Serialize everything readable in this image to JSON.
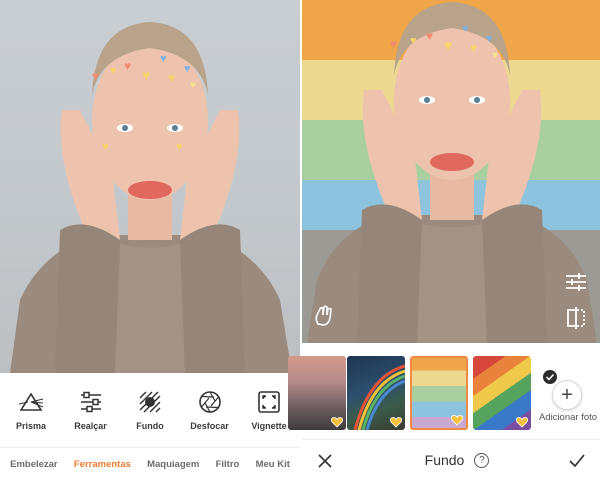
{
  "editor_tools": {
    "tools": [
      {
        "label": "Prisma",
        "icon": "prism-icon"
      },
      {
        "label": "Realçar",
        "icon": "sliders-icon"
      },
      {
        "label": "Fundo",
        "icon": "background-icon"
      },
      {
        "label": "Desfocar",
        "icon": "aperture-icon"
      },
      {
        "label": "Vignette",
        "icon": "vignette-icon"
      }
    ]
  },
  "bottom_nav": {
    "items": [
      {
        "label": "Embelezar",
        "active": false
      },
      {
        "label": "Ferramentas",
        "active": true
      },
      {
        "label": "Maquiagem",
        "active": false
      },
      {
        "label": "Filtro",
        "active": false
      },
      {
        "label": "Meu Kit",
        "active": false
      }
    ]
  },
  "background_panel": {
    "title": "Fundo",
    "add_photo_label": "Adicionar foto",
    "selected_index": 2,
    "thumbnails": [
      "sunset-sky",
      "rainbow-night",
      "pastel-rainbow-stripes",
      "rainbow-flag"
    ]
  },
  "icons": {
    "close": "close-icon",
    "confirm": "check-icon",
    "help": "?"
  },
  "colors": {
    "accent": "#f07d32",
    "selected_border": "#ef8a45",
    "text": "#333333"
  }
}
